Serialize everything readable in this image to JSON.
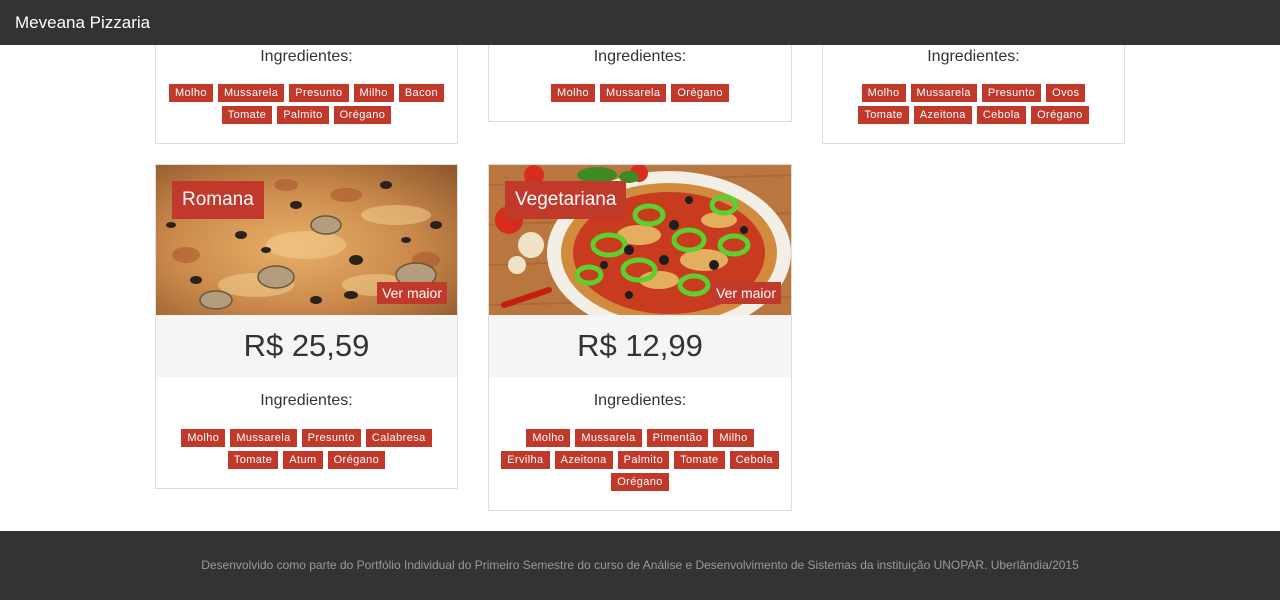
{
  "navbar": {
    "brand": "Meveana Pizzaria"
  },
  "top_cards": [
    {
      "ingredients_title": "Ingredientes:",
      "ingredients": [
        "Molho",
        "Mussarela",
        "Presunto",
        "Milho",
        "Bacon",
        "Tomate",
        "Palmito",
        "Orégano"
      ]
    },
    {
      "ingredients_title": "Ingredientes:",
      "ingredients": [
        "Molho",
        "Mussarela",
        "Orégano"
      ]
    },
    {
      "ingredients_title": "Ingredientes:",
      "ingredients": [
        "Molho",
        "Mussarela",
        "Presunto",
        "Ovos",
        "Tomate",
        "Azeitona",
        "Cebola",
        "Orégano"
      ]
    }
  ],
  "pizzas": [
    {
      "name": "Romana",
      "more_label": "Ver maior",
      "price": "R$ 25,59",
      "ingredients_title": "Ingredientes:",
      "ingredients": [
        "Molho",
        "Mussarela",
        "Presunto",
        "Calabresa",
        "Tomate",
        "Atum",
        "Orégano"
      ]
    },
    {
      "name": "Vegetariana",
      "more_label": "Ver maior",
      "price": "R$ 12,99",
      "ingredients_title": "Ingredientes:",
      "ingredients": [
        "Molho",
        "Mussarela",
        "Pimentão",
        "Milho",
        "Ervilha",
        "Azeitona",
        "Palmito",
        "Tomate",
        "Cebola",
        "Orégano"
      ]
    }
  ],
  "footer": {
    "text": "Desenvolvido como parte do Portfólio Individual do Primeiro Semestre do curso de Análise e Desenvolvimento de Sistemas da instituição UNOPAR. Uberlândia/2015"
  },
  "colors": {
    "accent": "#c0392b",
    "dark": "#333333",
    "price_bg": "#f5f5f5"
  }
}
